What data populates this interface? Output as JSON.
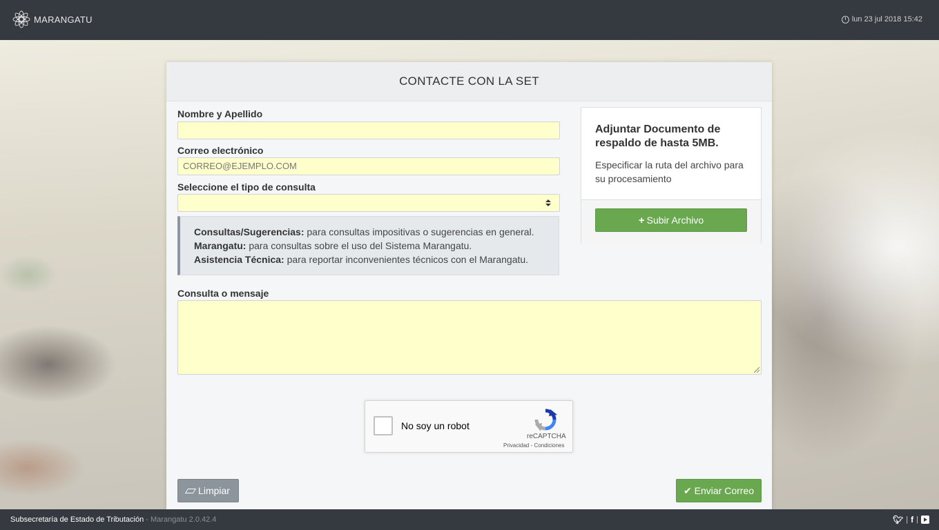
{
  "header": {
    "logo_text": "MARANGATU",
    "datetime": "lun 23 jul 2018 15:42"
  },
  "card": {
    "title": "CONTACTE CON LA SET"
  },
  "form": {
    "name_label": "Nombre y Apellido",
    "name_value": "",
    "email_label": "Correo electrónico",
    "email_placeholder": "CORREO@EJEMPLO.COM",
    "type_label": "Seleccione el tipo de consulta",
    "type_selected": "",
    "info": [
      {
        "term": "Consultas/Sugerencias:",
        "desc": " para consultas impositivas o sugerencias en general."
      },
      {
        "term": "Marangatu:",
        "desc": " para consultas sobre el uso del Sistema Marangatu."
      },
      {
        "term": "Asistencia Técnica:",
        "desc": " para reportar inconvenientes técnicos con el Marangatu."
      }
    ],
    "message_label": "Consulta o mensaje",
    "message_value": ""
  },
  "upload": {
    "title": "Adjuntar Documento de respaldo de hasta 5MB.",
    "description": "Especificar la ruta del archivo para su procesamiento",
    "button_label": "Subir Archivo"
  },
  "captcha": {
    "label": "No soy un robot",
    "brand": "reCAPTCHA",
    "links": "Privacidad - Condiciones"
  },
  "actions": {
    "clear_label": "Limpiar",
    "send_label": "Enviar Correo"
  },
  "footer": {
    "org": "Subsecretaría de Estado de Tributación",
    "version": " - Marangatu 2.0.42.4"
  },
  "colors": {
    "topbar": "#343a40",
    "input_bg": "#ffffcc",
    "success": "#6aa84f",
    "secondary": "#8c949c"
  },
  "icons": [
    "marangatu-logo",
    "clock-icon",
    "plus-icon",
    "eraser-icon",
    "check-icon",
    "recaptcha-logo",
    "twitter-icon",
    "facebook-icon",
    "youtube-icon"
  ]
}
